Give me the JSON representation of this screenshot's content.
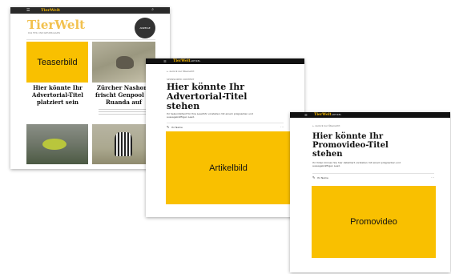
{
  "teaser_page": {
    "brand": "TierWelt",
    "masthead_logo": "TierWelt",
    "masthead_tagline": "DAS TIER- UND NATURMAGAZIN",
    "badge": "ANZEIGE",
    "image_label": "Teaserbild",
    "advert_title": "Hier könnte Ihr Advertorial-Titel platziert sein",
    "article_title": "Zürcher Nashorn frischt Genpool in Ruanda auf"
  },
  "article_page": {
    "brand": "TierWelt",
    "nav_label": "ARTIKEL",
    "back_link": "← zurück zur Übersicht",
    "kicker": "SPONSORED CONTENT",
    "title": "Hier könnte Ihr Advertorial-Titel stehen",
    "lead": "Ihr Sekundärtext für Ihre Leseführ vorstellen mit einem prägnanten und aussagekräftigen Lead.",
    "author": "Ihr Name",
    "image_label": "Artikelbild"
  },
  "promo_page": {
    "brand": "TierWelt",
    "nav_label": "ARTIKEL",
    "back_link": "← zurück zur Übersicht",
    "title": "Hier könnte Ihr Promovideo-Titel stehen",
    "lead": "Ihr Video können Sie hier detailliert vorstellen mit einem prägnanten und aussagekräftigen Lead.",
    "author": "Ihr Name",
    "video_label": "Promovideo"
  },
  "colors": {
    "accent": "#f9c000",
    "topbar": "#111111",
    "logo": "#f5b800"
  }
}
